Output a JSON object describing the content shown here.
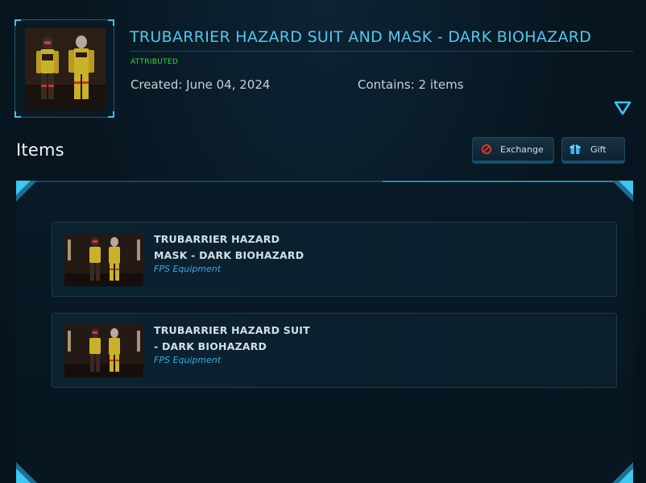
{
  "header": {
    "title": "TRUBARRIER HAZARD SUIT AND MASK - DARK BIOHAZARD",
    "status_badge": "ATTRIBUTED",
    "created": "Created: June 04, 2024",
    "contains": "Contains: 2 items",
    "thumbnail_icon": "hazard-suit-figures"
  },
  "items_section": {
    "heading": "Items",
    "exchange_label": "Exchange",
    "exchange_icon": "prohibited-icon",
    "gift_label": "Gift",
    "gift_icon": "gift-box-icon"
  },
  "items": [
    {
      "name_line1": "TRUBARRIER HAZARD",
      "name_line2": "MASK - DARK BIOHAZARD",
      "category": "FPS Equipment"
    },
    {
      "name_line1": "TRUBARRIER HAZARD SUIT",
      "name_line2": "- DARK BIOHAZARD",
      "category": "FPS Equipment"
    }
  ],
  "colors": {
    "accent": "#56c6ec",
    "attributed": "#35d63a",
    "category": "#38a9e0",
    "background": "#071621"
  }
}
